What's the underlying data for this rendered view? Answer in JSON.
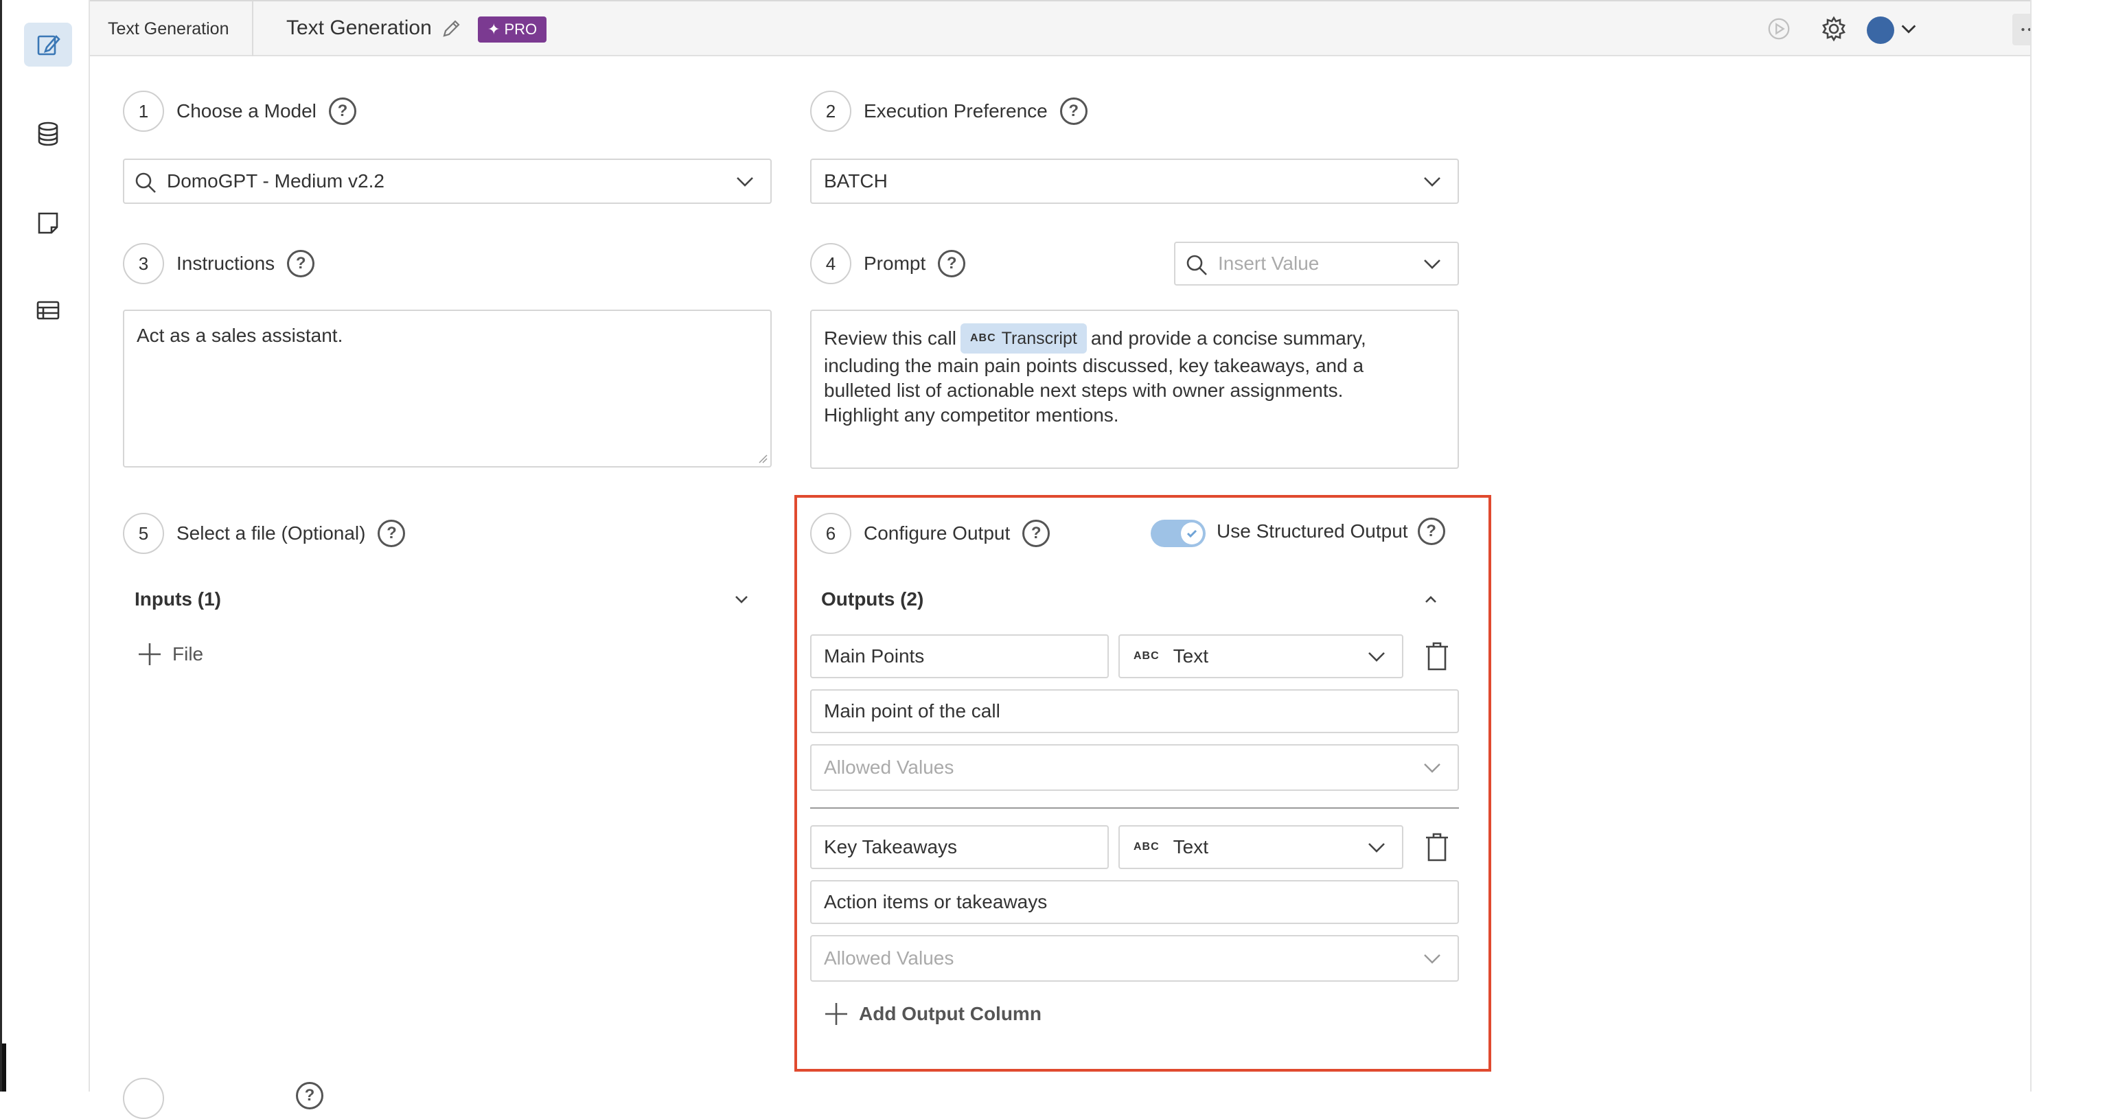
{
  "breadcrumb": "Text Generation",
  "title": "Text Generation",
  "badge": "PRO",
  "steps": {
    "s1": {
      "num": "1",
      "label": "Choose a Model"
    },
    "s2": {
      "num": "2",
      "label": "Execution Preference"
    },
    "s3": {
      "num": "3",
      "label": "Instructions"
    },
    "s4": {
      "num": "4",
      "label": "Prompt"
    },
    "s5": {
      "num": "5",
      "label": "Select a file (Optional)"
    },
    "s6": {
      "num": "6",
      "label": "Configure Output"
    }
  },
  "model": {
    "value": "DomoGPT - Medium v2.2"
  },
  "execution": {
    "value": "BATCH"
  },
  "insert_value": {
    "placeholder": "Insert Value"
  },
  "instructions": {
    "value": "Act as a sales assistant."
  },
  "prompt": {
    "before_chip": "Review this call",
    "chip_type": "ABC",
    "chip_label": "Transcript",
    "after_chip": "and provide a concise summary,",
    "line2": "including the main pain points discussed, key takeaways, and a",
    "line3": "bulleted list of actionable next steps with owner assignments.",
    "line4": "Highlight any competitor mentions."
  },
  "inputs": {
    "header": "Inputs (1)",
    "add_file": "File"
  },
  "structured_output": {
    "label": "Use Structured Output",
    "enabled": true
  },
  "outputs": {
    "header": "Outputs (2)",
    "items": [
      {
        "name": "Main Points",
        "type_icon": "ABC",
        "type": "Text",
        "description": "Main point of the call",
        "allowed_placeholder": "Allowed Values"
      },
      {
        "name": "Key Takeaways",
        "type_icon": "ABC",
        "type": "Text",
        "description": "Action items or takeaways",
        "allowed_placeholder": "Allowed Values"
      }
    ],
    "add_label": "Add Output Column"
  },
  "colors": {
    "accent": "#7b3a91",
    "highlight": "#e04a2f",
    "avatar": "#3a67a5",
    "toggle": "#9ec2e6"
  }
}
